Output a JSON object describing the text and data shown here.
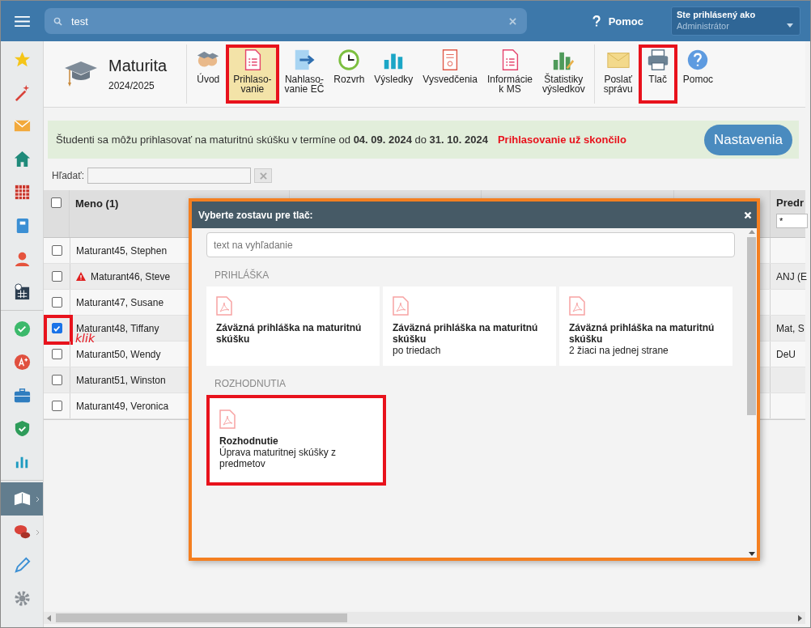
{
  "topbar": {
    "search": {
      "value": "test"
    },
    "help": "Pomoc",
    "user": {
      "caption": "Ste prihlásený ako",
      "name": "Administrátor"
    }
  },
  "sidebar": {
    "groups": [
      [
        {
          "selected": false
        },
        {
          "selected": false
        },
        {
          "selected": false
        },
        {
          "selected": false
        },
        {
          "selected": false
        },
        {
          "selected": false
        },
        {
          "selected": false
        },
        {
          "selected": false
        }
      ],
      [
        {
          "selected": false
        },
        {
          "selected": false
        },
        {
          "selected": false
        },
        {
          "selected": false
        },
        {
          "selected": false
        }
      ],
      [
        {
          "selected": true
        },
        {
          "selected": false
        },
        {
          "selected": false
        },
        {
          "selected": false
        }
      ]
    ]
  },
  "module": {
    "title": "Maturita",
    "year": "2024/2025"
  },
  "toolbar": {
    "groups": [
      [
        {
          "label": "Úvod",
          "selected": false,
          "highlighted": false
        },
        {
          "label": "Prihlaso-\nvanie",
          "selected": true,
          "highlighted": true
        },
        {
          "label": "Nahlaso-\nvanie EČ",
          "selected": false,
          "highlighted": false
        },
        {
          "label": "Rozvrh",
          "selected": false,
          "highlighted": false
        },
        {
          "label": "Výsledky",
          "selected": false,
          "highlighted": false
        },
        {
          "label": "Vysvedčenia",
          "selected": false,
          "highlighted": false
        },
        {
          "label": "Informácie\nk MS",
          "selected": false,
          "highlighted": false
        },
        {
          "label": "Štatistiky\nvýsledkov",
          "selected": false,
          "highlighted": false
        }
      ],
      [
        {
          "label": "Poslať\nsprávu",
          "selected": false,
          "highlighted": false
        },
        {
          "label": "Tlač",
          "selected": false,
          "highlighted": true
        },
        {
          "label": "Pomoc",
          "selected": false,
          "highlighted": false
        }
      ]
    ]
  },
  "banner": {
    "text": "Študenti sa môžu prihlasovať na maturitnú skúšku v termíne od **04. 09. 2024** do **31. 10. 2024**",
    "warning": "Prihlasovanie už skončilo",
    "button": "Nastavenia"
  },
  "filter": {
    "label": "Hľadať:"
  },
  "table": {
    "all_checked": false,
    "columns": [
      {
        "label": "Meno (1)"
      },
      {
        "label": "Predr",
        "filter": "*"
      }
    ],
    "rows": [
      {
        "name": "Maturant45, Stephen",
        "checked": false,
        "warning": false,
        "highlighted": false
      },
      {
        "name": "Maturant46, Steve",
        "checked": false,
        "warning": true,
        "subject": "ANJ (E",
        "highlighted": false
      },
      {
        "name": "Maturant47, Susane",
        "checked": false,
        "warning": false,
        "highlighted": false
      },
      {
        "name": "Maturant48, Tiffany",
        "checked": true,
        "warning": false,
        "subject": "Mat, S",
        "highlighted": true
      },
      {
        "name": "Maturant50, Wendy",
        "checked": false,
        "warning": false,
        "subject": "DeU",
        "highlighted": false
      },
      {
        "name": "Maturant51, Winston",
        "checked": false,
        "warning": false,
        "highlighted": false
      },
      {
        "name": "Maturant49, Veronica",
        "checked": false,
        "warning": false,
        "highlighted": false
      }
    ]
  },
  "annotation": "klik",
  "dialog": {
    "title": "Vyberte zostavu pre tlač:",
    "search": {
      "placeholder": "text na vyhľadanie"
    },
    "sections": [
      {
        "title": "PRIHLÁŠKA",
        "reports": [
          {
            "title": "Záväzná prihláška na maturitnú skúšku",
            "highlighted": false
          },
          {
            "title": "Záväzná prihláška na maturitnú skúšku",
            "subtitle": "po triedach",
            "highlighted": false
          },
          {
            "title": "Záväzná prihláška na maturitnú skúšku",
            "subtitle": "2 žiaci na jednej strane",
            "highlighted": false
          }
        ]
      },
      {
        "title": "ROZHODNUTIA",
        "reports": [
          {
            "title": "Rozhodnutie",
            "subtitle": "Úprava maturitnej skúšky z predmetov",
            "highlighted": true
          }
        ]
      }
    ]
  }
}
